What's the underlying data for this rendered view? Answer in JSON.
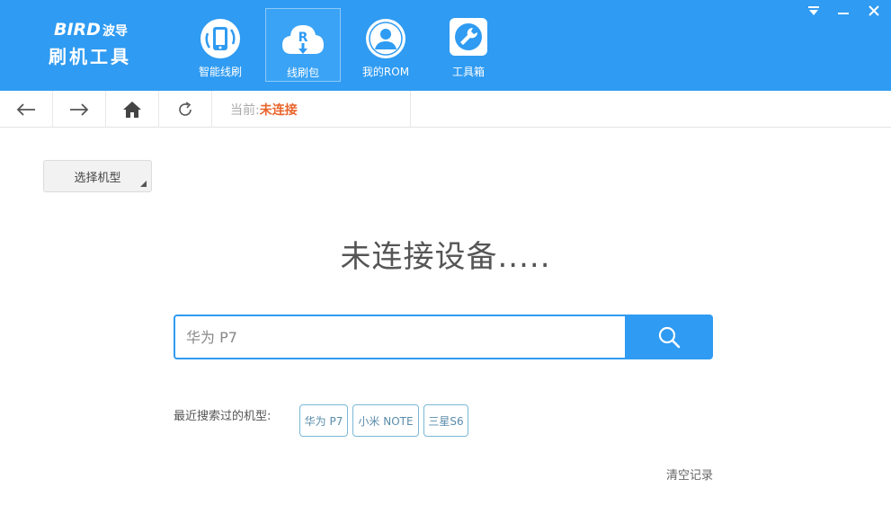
{
  "app": {
    "logo_brand": "BIRD",
    "logo_brand_cn": "波导",
    "logo_title": "刷机工具"
  },
  "nav": [
    {
      "label": "智能线刷",
      "icon": "phone-refresh-icon"
    },
    {
      "label": "线刷包",
      "icon": "cloud-download-icon",
      "active": true
    },
    {
      "label": "我的ROM",
      "icon": "user-icon"
    },
    {
      "label": "工具箱",
      "icon": "wrench-icon"
    }
  ],
  "window_controls": [
    "menu-icon",
    "minimize-icon",
    "close-icon"
  ],
  "toolbar": {
    "current_label": "当前:",
    "current_value": "未连接"
  },
  "main": {
    "model_select_label": "选择机型",
    "status_text": "未连接设备.....",
    "search_placeholder": "华为 P7",
    "recent_label": "最近搜索过的机型:",
    "recent_tags": [
      "华为 P7",
      "小米 NOTE",
      "三星S6"
    ],
    "clear_label": "清空记录"
  },
  "colors": {
    "brand_blue": "#2f9bf2",
    "status_red": "#e8642c",
    "tag_border": "#7ab8d6"
  }
}
